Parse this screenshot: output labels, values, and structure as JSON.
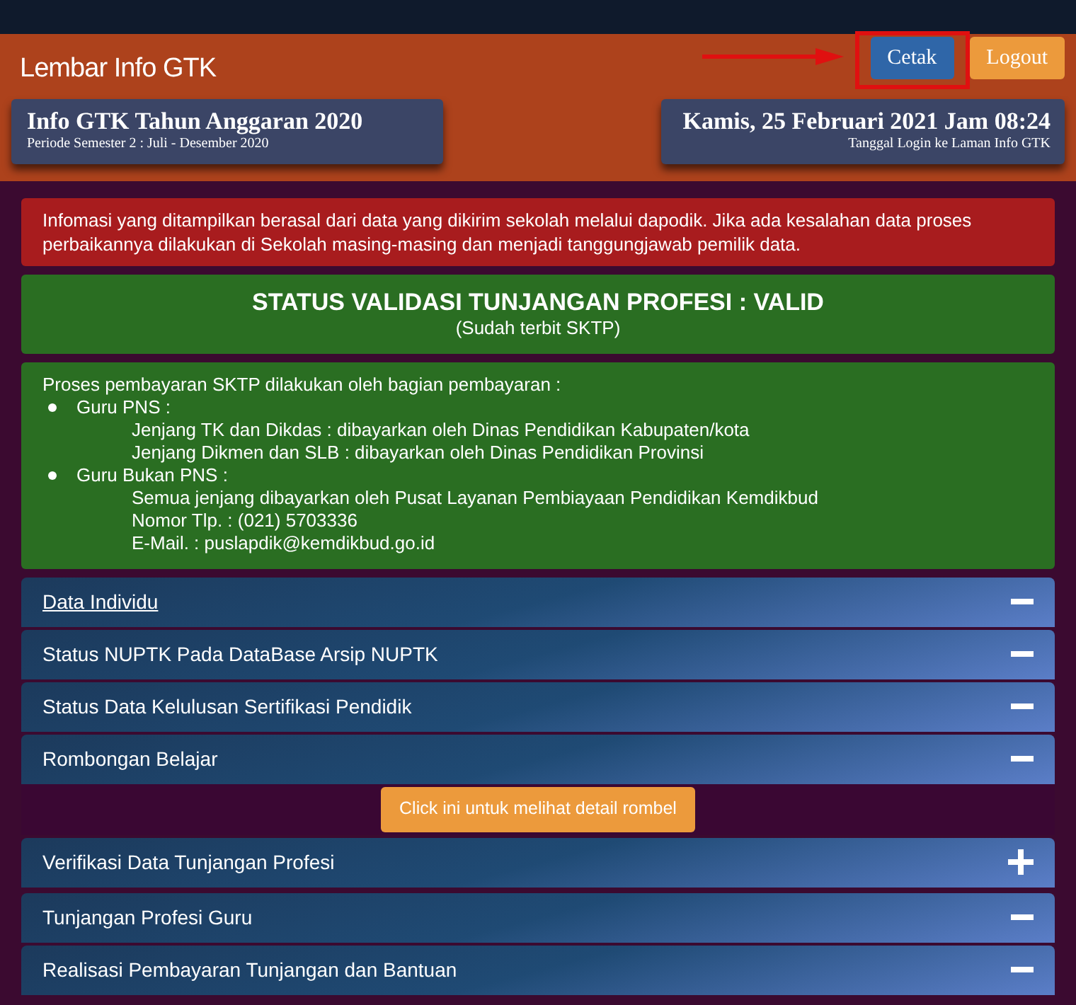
{
  "header": {
    "title": "Lembar Info GTK",
    "buttons": [
      {
        "label": "Cetak",
        "kind": "primary",
        "highlighted": true
      },
      {
        "label": "Logout",
        "kind": "warning",
        "highlighted": false
      }
    ],
    "period_card": {
      "title": "Info GTK Tahun Anggaran 2020",
      "subtitle": "Periode Semester 2 : Juli - Desember 2020"
    },
    "login_card": {
      "title": "Kamis, 25 Februari 2021 Jam 08:24",
      "subtitle": "Tanggal Login ke Laman Info GTK"
    }
  },
  "notice": "Infomasi yang ditampilkan berasal dari data yang dikirim sekolah melalui dapodik. Jika ada kesalahan data proses perbaikannya dilakukan di Sekolah masing-masing dan menjadi tanggungjawab pemilik data.",
  "status": {
    "title": "STATUS VALIDASI TUNJANGAN PROFESI : VALID",
    "subtitle": "(Sudah terbit SKTP)"
  },
  "payment": {
    "intro": "Proses pembayaran SKTP dilakukan oleh bagian pembayaran :",
    "groups": [
      {
        "label": "Guru PNS :",
        "lines": [
          "Jenjang TK dan Dikdas : dibayarkan oleh Dinas Pendidikan Kabupaten/kota",
          "Jenjang Dikmen dan SLB : dibayarkan oleh Dinas Pendidikan Provinsi"
        ]
      },
      {
        "label": "Guru Bukan PNS :",
        "lines": [
          "Semua jenjang dibayarkan oleh Pusat Layanan Pembiayaan Pendidikan Kemdikbud",
          "Nomor Tlp. : (021) 5703336",
          "E-Mail. : puslapdik@kemdikbud.go.id"
        ]
      }
    ]
  },
  "sections": [
    {
      "title": "Data Individu",
      "expanded": true,
      "underlined": true
    },
    {
      "title": "Status NUPTK Pada DataBase Arsip NUPTK",
      "expanded": true,
      "underlined": false
    },
    {
      "title": "Status Data Kelulusan Sertifikasi Pendidik",
      "expanded": true,
      "underlined": false
    },
    {
      "title": "Rombongan Belajar",
      "expanded": true,
      "underlined": false,
      "body_button": "Click ini untuk melihat detail rombel"
    },
    {
      "title": "Verifikasi Data Tunjangan Profesi",
      "expanded": false,
      "underlined": false
    },
    {
      "title": "Tunjangan Profesi Guru",
      "expanded": true,
      "underlined": false
    },
    {
      "title": "Realisasi Pembayaran Tunjangan dan Bantuan",
      "expanded": true,
      "underlined": false
    }
  ]
}
